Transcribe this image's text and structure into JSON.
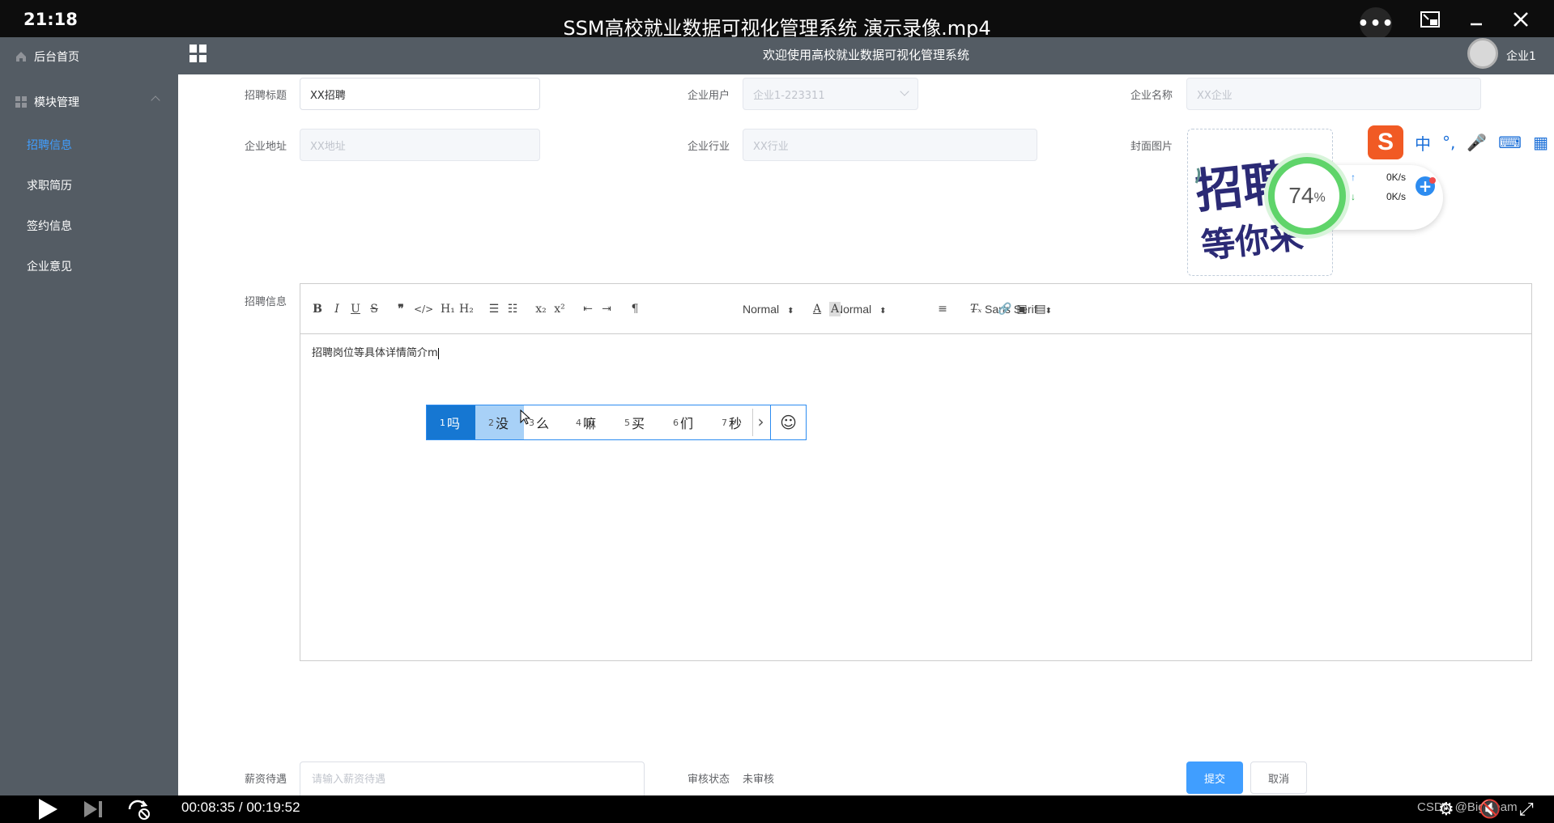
{
  "player": {
    "clock": "21:18",
    "title": "SSM高校就业数据可视化管理系统 演示录像.mp4",
    "time": "00:08:35 / 00:19:52",
    "progress": 0.432,
    "watermark": "CSDN @BigDeam"
  },
  "sidebar": {
    "home": "后台首页",
    "module": "模块管理",
    "items": [
      "招聘信息",
      "求职简历",
      "签约信息",
      "企业意见"
    ]
  },
  "header": {
    "welcome": "欢迎使用高校就业数据可视化管理系统",
    "user": "企业1"
  },
  "form": {
    "title_label": "招聘标题",
    "title_value": "XX招聘",
    "company_user_label": "企业用户",
    "company_user_value": "企业1-223311",
    "company_name_label": "企业名称",
    "company_name_value": "XX企业",
    "address_label": "企业地址",
    "address_value": "XX地址",
    "industry_label": "企业行业",
    "industry_value": "XX行业",
    "cover_label": "封面图片",
    "info_label": "招聘信息",
    "editor_text": "招聘岗位等具体详情简介m",
    "salary_label": "薪资待遇",
    "salary_placeholder": "请输入薪资待遇",
    "review_label": "审核状态",
    "review_value": "未审核",
    "submit": "提交",
    "cancel": "取消",
    "cover_art_text": [
      "招聘",
      "等你来!"
    ]
  },
  "toolbar": {
    "header_picker": "Normal",
    "size_picker": "Normal",
    "font_picker": "Sans Serif"
  },
  "ime": {
    "candidates": [
      {
        "num": "1",
        "text": "吗"
      },
      {
        "num": "2",
        "text": "没"
      },
      {
        "num": "3",
        "text": "么"
      },
      {
        "num": "4",
        "text": "嘛"
      },
      {
        "num": "5",
        "text": "买"
      },
      {
        "num": "6",
        "text": "们"
      },
      {
        "num": "7",
        "text": "秒"
      }
    ]
  },
  "sogou": {
    "logo": "S",
    "mode": "中",
    "percent": "74",
    "percent_unit": "%",
    "upload": "0K/s",
    "download": "0K/s"
  },
  "colors": {
    "sidebar_bg": "#545c64",
    "accent": "#409eff",
    "progress": "#f04b3a"
  }
}
